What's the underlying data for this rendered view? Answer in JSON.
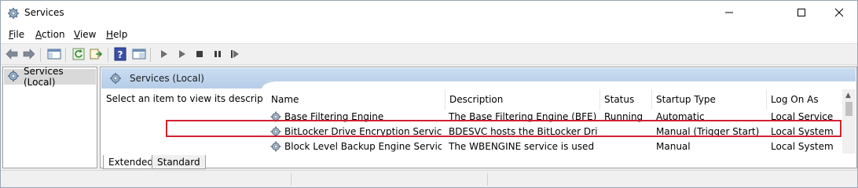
{
  "window": {
    "title": "Services",
    "controls": {
      "minimize_icon": "minimize-icon",
      "maximize_icon": "maximize-icon",
      "close_icon": "close-icon"
    }
  },
  "menu": {
    "items": [
      {
        "label": "File",
        "underline": "F",
        "rest": "ile"
      },
      {
        "label": "Action",
        "underline": "A",
        "rest": "ction"
      },
      {
        "label": "View",
        "underline": "V",
        "rest": "iew"
      },
      {
        "label": "Help",
        "underline": "H",
        "rest": "elp"
      }
    ]
  },
  "toolbar": {
    "buttons": [
      "back-icon",
      "forward-icon",
      "show-hide-console-tree-icon",
      "refresh-icon",
      "export-list-icon",
      "help-icon",
      "properties-icon",
      "start-icon",
      "start-alt-icon",
      "stop-icon",
      "pause-icon",
      "restart-icon"
    ]
  },
  "tree": {
    "root_label": "Services (Local)"
  },
  "pane": {
    "header_title": "Services (Local)",
    "description_prompt": "Select an item to view its description."
  },
  "table": {
    "columns": [
      "Name",
      "Description",
      "Status",
      "Startup Type",
      "Log On As"
    ],
    "rows": [
      {
        "name": "Base Filtering Engine",
        "description": "The Base Filtering Engine (BFE) is ...",
        "status": "Running",
        "startup": "Automatic",
        "logon": "Local Service"
      },
      {
        "name": "BitLocker Drive Encryption Service",
        "description": "BDESVC hosts the BitLocker Drive ...",
        "status": "",
        "startup": "Manual (Trigger Start)",
        "logon": "Local System"
      },
      {
        "name": "Block Level Backup Engine Service",
        "description": "The WBENGINE service is used by ...",
        "status": "",
        "startup": "Manual",
        "logon": "Local System"
      }
    ],
    "highlighted_row_index": 1,
    "highlight_color": "#d32030"
  },
  "tabs": {
    "extended": "Extended",
    "standard": "Standard",
    "active": "Extended"
  },
  "colors": {
    "header_gradient_top": "#c9dcf1",
    "header_gradient_bottom": "#b6cde8",
    "tree_selected": "#d9d9d9"
  }
}
